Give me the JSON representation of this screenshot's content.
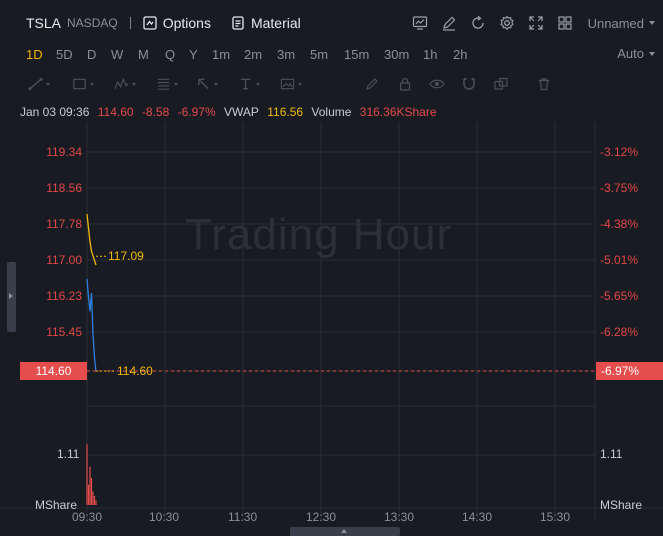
{
  "header": {
    "ticker": "TSLA",
    "exchange": "NASDAQ",
    "options_label": "Options",
    "material_label": "Material",
    "layout_name": "Unnamed"
  },
  "timeframes": [
    "1D",
    "5D",
    "D",
    "W",
    "M",
    "Q",
    "Y",
    "1m",
    "2m",
    "3m",
    "5m",
    "15m",
    "30m",
    "1h",
    "2h"
  ],
  "active_timeframe": "1D",
  "scale_mode": "Auto",
  "info": {
    "time": "Jan 03 09:36",
    "price": "114.60",
    "change": "-8.58",
    "change_pct": "-6.97%",
    "vwap_label": "VWAP",
    "vwap": "116.56",
    "volume_label": "Volume",
    "volume": "316.36KShare"
  },
  "watermark": "Trading Hour",
  "price_axis_left": [
    "119.34",
    "118.56",
    "117.78",
    "117.00",
    "116.23",
    "115.45"
  ],
  "price_axis_right": [
    "-3.12%",
    "-3.75%",
    "-4.38%",
    "-5.01%",
    "-5.65%",
    "-6.28%"
  ],
  "current_price_tag": "114.60",
  "current_pct_tag": "-6.97%",
  "vwap_line_label": "117.09",
  "price_line_label": "114.60",
  "volume_axis": {
    "value_left": "1.11",
    "value_right": "1.11",
    "unit": "MShare"
  },
  "time_axis": [
    "09:30",
    "10:30",
    "11:30",
    "12:30",
    "13:30",
    "14:30",
    "15:30"
  ],
  "colors": {
    "background": "#191b22",
    "grid": "#2a2d36",
    "down": "#e64d4d",
    "vwap": "#f0b90b",
    "price_line": "#2f7fe0",
    "active": "#f4b400"
  },
  "chart_data": {
    "type": "line",
    "x": [
      "09:30",
      "09:31",
      "09:32",
      "09:33",
      "09:34",
      "09:35",
      "09:36"
    ],
    "series": [
      {
        "name": "VWAP",
        "values": [
          118.0,
          117.7,
          117.4,
          117.2,
          117.1,
          117.0,
          116.9
        ]
      },
      {
        "values": [
          116.6,
          116.2,
          115.9,
          116.3,
          115.4,
          114.9,
          114.6
        ]
      }
    ],
    "volume": [
      1.35,
      0.45,
      0.85,
      0.6,
      0.3,
      0.2,
      0.1
    ],
    "ylim": [
      114.4,
      119.8
    ]
  }
}
